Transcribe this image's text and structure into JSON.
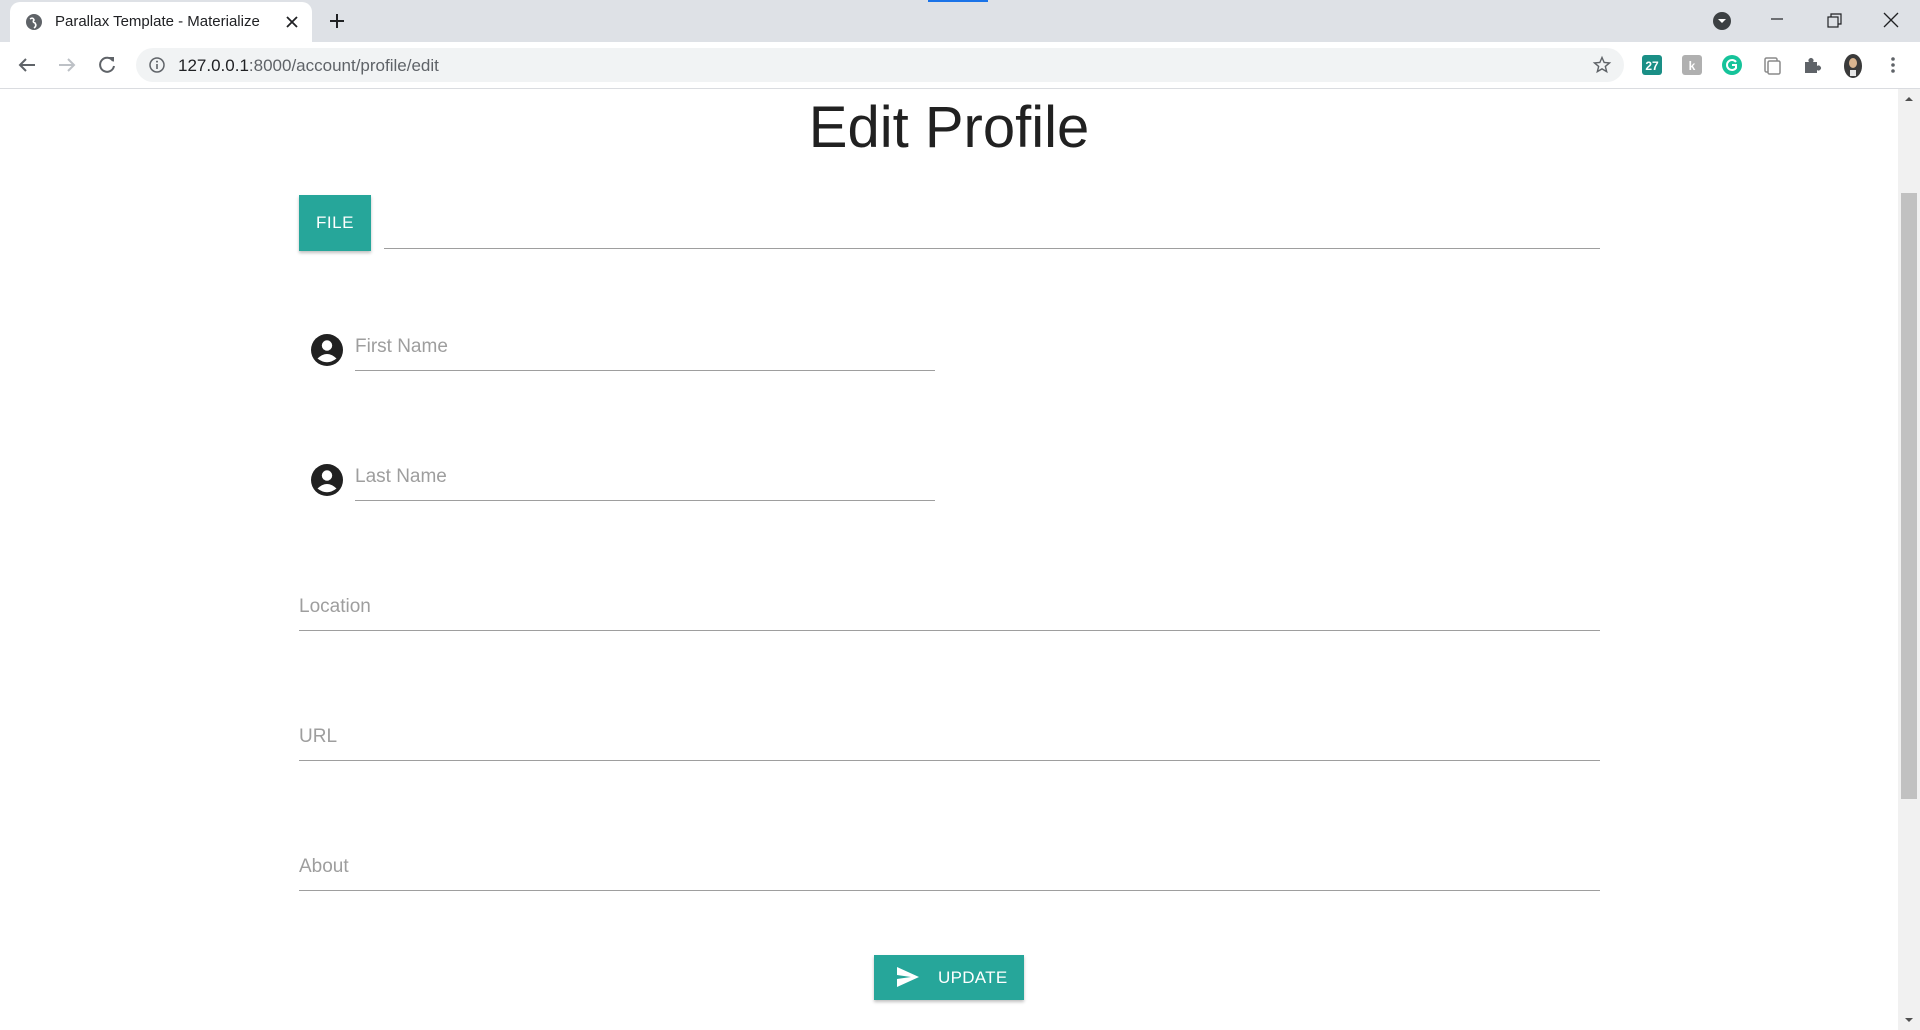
{
  "browser": {
    "tab_title": "Parallax Template - Materialize",
    "url_host": "127.0.0.1",
    "url_path": ":8000/account/profile/edit",
    "extensions": [
      "calendar-27-icon",
      "k-extension-icon",
      "grammarly-icon",
      "clipboard-icon",
      "puzzle-icon",
      "avatar-icon"
    ],
    "accent_color": "#1a73e8"
  },
  "page": {
    "title": "Edit Profile",
    "file_button_label": "FILE",
    "fields": {
      "first_name": "First Name",
      "last_name": "Last Name",
      "location": "Location",
      "url": "URL",
      "about": "About"
    },
    "update_button_label": "UPDATE",
    "accent_color": "#26a69a"
  }
}
